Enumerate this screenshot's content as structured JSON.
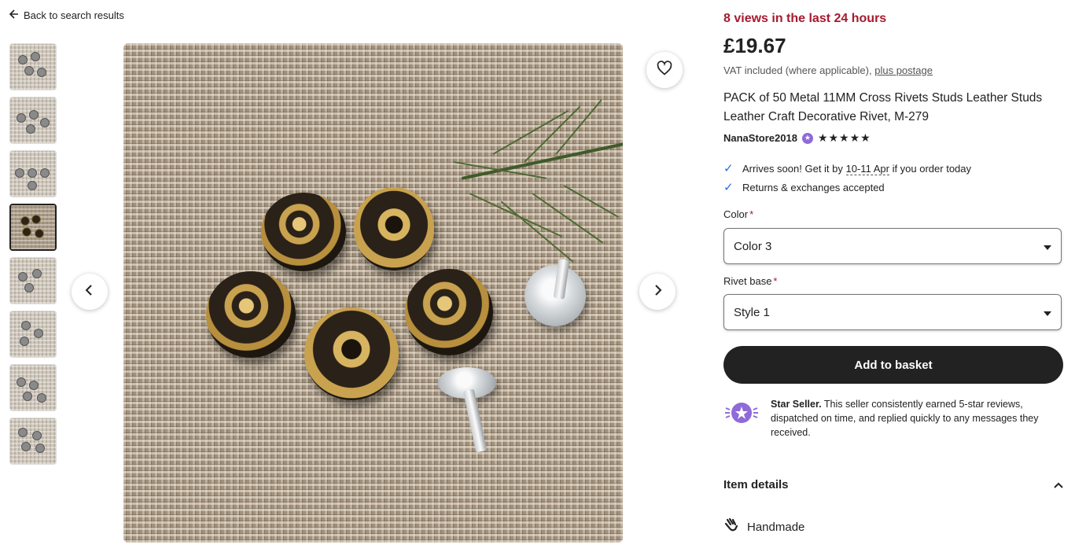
{
  "nav": {
    "back_label": "Back to search results"
  },
  "gallery": {
    "thumbnail_count": 8,
    "active_thumbnail": 4,
    "main_image_alt": "Metal cross rivets on burlap"
  },
  "product": {
    "views_text": "8 views in the last 24 hours",
    "price": "£19.67",
    "vat_text": "VAT included (where applicable),",
    "postage_link": "plus postage",
    "title": "PACK of 50 Metal 11MM Cross Rivets Studs Leather Studs Leather Craft Decorative Rivet, M-279",
    "shop_name": "NanaStore2018",
    "stars": "★★★★★",
    "rating": 5
  },
  "delivery": {
    "arrives_prefix": "Arrives soon! Get it by",
    "arrives_date": "10-11 Apr",
    "arrives_suffix": "if you order today",
    "returns": "Returns & exchanges accepted"
  },
  "options": {
    "color_label": "Color",
    "color_value": "Color 3",
    "rivet_label": "Rivet base",
    "rivet_value": "Style 1",
    "required_mark": "*"
  },
  "actions": {
    "add_to_basket": "Add to basket"
  },
  "star_seller": {
    "title": "Star Seller.",
    "text": "This seller consistently earned 5-star reviews, dispatched on time, and replied quickly to any messages they received."
  },
  "details": {
    "heading": "Item details",
    "handmade": "Handmade"
  },
  "colors": {
    "accent": "#a61a2e",
    "button": "#222222",
    "badge": "#8f6ad8",
    "check": "#2a6fe0"
  }
}
